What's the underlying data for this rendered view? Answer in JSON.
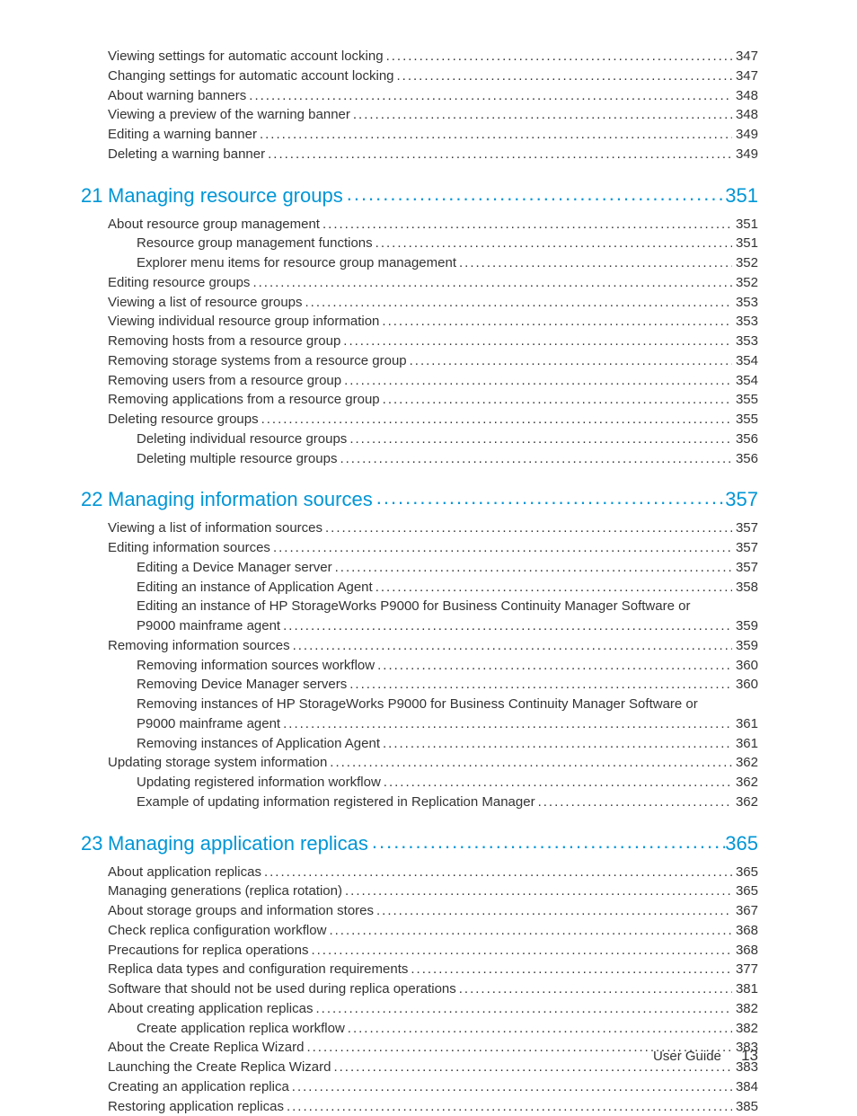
{
  "footer": {
    "label": "User Guide",
    "page": "13"
  },
  "top_entries": [
    {
      "title": "Viewing settings for automatic account locking",
      "page": "347",
      "indent": 1
    },
    {
      "title": "Changing settings for automatic account locking",
      "page": "347",
      "indent": 1
    },
    {
      "title": "About warning banners",
      "page": "348",
      "indent": 1
    },
    {
      "title": "Viewing a preview of the warning banner",
      "page": "348",
      "indent": 1
    },
    {
      "title": "Editing a warning banner",
      "page": "349",
      "indent": 1
    },
    {
      "title": "Deleting a warning banner",
      "page": "349",
      "indent": 1
    }
  ],
  "chapters": [
    {
      "num": "21",
      "title": "Managing resource groups",
      "page": "351",
      "entries": [
        {
          "title": "About resource group management",
          "page": "351",
          "indent": 1
        },
        {
          "title": "Resource group management functions",
          "page": "351",
          "indent": 2
        },
        {
          "title": "Explorer menu items for resource group management",
          "page": "352",
          "indent": 2
        },
        {
          "title": "Editing resource groups",
          "page": "352",
          "indent": 1
        },
        {
          "title": "Viewing a list of resource groups",
          "page": "353",
          "indent": 1
        },
        {
          "title": "Viewing individual resource group information",
          "page": "353",
          "indent": 1
        },
        {
          "title": "Removing hosts from a resource group",
          "page": "353",
          "indent": 1
        },
        {
          "title": "Removing storage systems from a resource group",
          "page": "354",
          "indent": 1
        },
        {
          "title": "Removing users from a resource group",
          "page": "354",
          "indent": 1
        },
        {
          "title": "Removing applications from a resource group",
          "page": "355",
          "indent": 1
        },
        {
          "title": "Deleting resource groups",
          "page": "355",
          "indent": 1
        },
        {
          "title": "Deleting individual resource groups",
          "page": "356",
          "indent": 2
        },
        {
          "title": "Deleting multiple resource groups",
          "page": "356",
          "indent": 2
        }
      ]
    },
    {
      "num": "22",
      "title": "Managing information sources",
      "page": "357",
      "entries": [
        {
          "title": "Viewing a list of information sources",
          "page": "357",
          "indent": 1
        },
        {
          "title": "Editing information sources",
          "page": "357",
          "indent": 1
        },
        {
          "title": "Editing a Device Manager server",
          "page": "357",
          "indent": 2
        },
        {
          "title": "Editing an instance of Application Agent",
          "page": "358",
          "indent": 2
        },
        {
          "multi": true,
          "line1": "Editing an instance of HP StorageWorks P9000 for Business Continuity Manager Software or",
          "line2": "P9000 mainframe agent",
          "page": "359",
          "indent": 2
        },
        {
          "title": "Removing information sources",
          "page": "359",
          "indent": 1
        },
        {
          "title": "Removing information sources workflow",
          "page": "360",
          "indent": 2
        },
        {
          "title": "Removing Device Manager servers",
          "page": "360",
          "indent": 2
        },
        {
          "multi": true,
          "line1": "Removing instances of HP StorageWorks P9000 for Business Continuity Manager Software or",
          "line2": "P9000 mainframe agent",
          "page": "361",
          "indent": 2
        },
        {
          "title": "Removing instances of Application Agent",
          "page": "361",
          "indent": 2
        },
        {
          "title": "Updating storage system information",
          "page": "362",
          "indent": 1
        },
        {
          "title": "Updating registered information workflow",
          "page": "362",
          "indent": 2
        },
        {
          "title": "Example of updating information registered in Replication Manager",
          "page": "362",
          "indent": 2
        }
      ]
    },
    {
      "num": "23",
      "title": "Managing application replicas",
      "page": "365",
      "entries": [
        {
          "title": "About application replicas",
          "page": "365",
          "indent": 1
        },
        {
          "title": "Managing generations (replica rotation)",
          "page": "365",
          "indent": 1
        },
        {
          "title": "About storage groups and information stores",
          "page": "367",
          "indent": 1
        },
        {
          "title": "Check replica configuration workflow",
          "page": "368",
          "indent": 1
        },
        {
          "title": "Precautions for replica operations",
          "page": "368",
          "indent": 1
        },
        {
          "title": "Replica data types and configuration requirements",
          "page": "377",
          "indent": 1
        },
        {
          "title": "Software that should not be used during replica operations",
          "page": "381",
          "indent": 1
        },
        {
          "title": "About creating application replicas",
          "page": "382",
          "indent": 1
        },
        {
          "title": "Create application replica workflow",
          "page": "382",
          "indent": 2
        },
        {
          "title": "About the Create Replica Wizard",
          "page": "383",
          "indent": 1
        },
        {
          "title": "Launching the Create Replica Wizard",
          "page": "383",
          "indent": 1
        },
        {
          "title": "Creating an application replica",
          "page": "384",
          "indent": 1
        },
        {
          "title": "Restoring application replicas",
          "page": "385",
          "indent": 1
        }
      ]
    }
  ]
}
